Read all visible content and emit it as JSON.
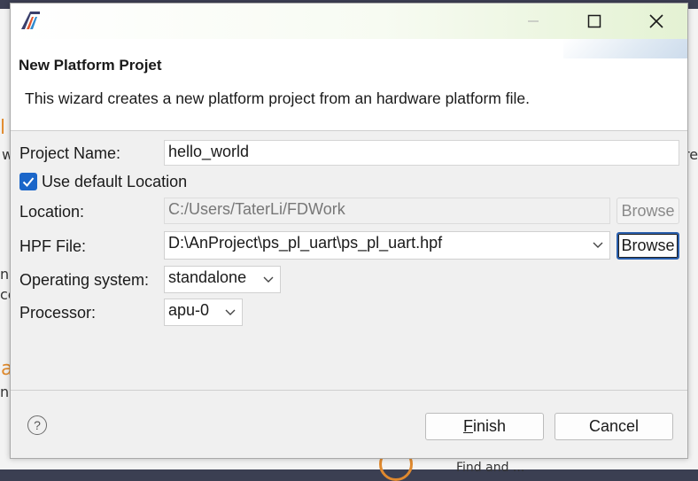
{
  "background": {
    "fragments": [
      "l",
      "w",
      "re",
      "ne",
      "ce",
      "a",
      "n",
      "Find and ..."
    ]
  },
  "dialog": {
    "title": "New Platform Projet",
    "description": "This wizard creates a new platform project from an hardware platform file.",
    "project_name": {
      "label": "Project Name:",
      "value": "hello_world"
    },
    "use_default_location": {
      "label": "Use default Location",
      "checked": true
    },
    "location": {
      "label": "Location:",
      "value": "C:/Users/TaterLi/FDWork",
      "browse": "Browse"
    },
    "hpf_file": {
      "label": "HPF File:",
      "value": "D:\\AnProject\\ps_pl_uart\\ps_pl_uart.hpf",
      "browse": "Browse"
    },
    "operating_system": {
      "label": "Operating system:",
      "value": "standalone"
    },
    "processor": {
      "label": "Processor:",
      "value": "apu-0"
    },
    "buttons": {
      "finish_mnemonic": "F",
      "finish_rest": "inish",
      "cancel": "Cancel"
    },
    "help_glyph": "?"
  },
  "icons": {
    "app": "app-logo-icon",
    "minimize": "minimize-icon",
    "maximize": "maximize-icon",
    "close": "close-icon",
    "check": "checkmark-icon",
    "chevron": "chevron-down-icon",
    "help": "help-icon"
  },
  "colors": {
    "accent": "#1b66c9",
    "focus_border": "#2a5fad",
    "background_orange": "#e08a2c"
  }
}
